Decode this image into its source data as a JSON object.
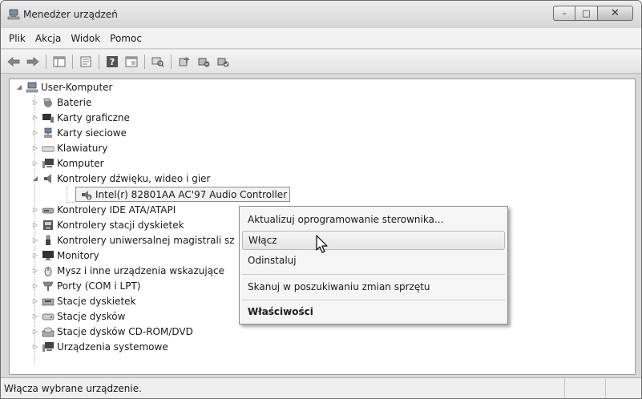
{
  "window": {
    "title": "Menedżer urządzeń",
    "title_icon": "computer-icon"
  },
  "caption": {
    "minimize": "–",
    "maximize": "□",
    "close": "✕"
  },
  "menubar": {
    "items": [
      "Plik",
      "Akcja",
      "Widok",
      "Pomoc"
    ]
  },
  "toolbar": {
    "buttons": [
      "back-arrow-icon",
      "forward-arrow-icon",
      "show-hide-console-tree-icon",
      "properties-icon",
      "help-icon",
      "console-view-icon",
      "scan-hardware-icon",
      "update-driver-icon",
      "disable-device-icon",
      "enable-device-icon"
    ]
  },
  "tree": {
    "root": {
      "label": "User-Komputer",
      "icon": "computer-icon",
      "expanded": true
    },
    "categories": [
      {
        "label": "Baterie",
        "icon": "battery-icon"
      },
      {
        "label": "Karty graficzne",
        "icon": "display-adapter-icon"
      },
      {
        "label": "Karty sieciowe",
        "icon": "network-adapter-icon"
      },
      {
        "label": "Klawiatury",
        "icon": "keyboard-icon"
      },
      {
        "label": "Komputer",
        "icon": "computer-icon"
      },
      {
        "label": "Kontrolery dźwięku, wideo i gier",
        "icon": "speaker-icon",
        "expanded": true
      },
      {
        "label": "Kontrolery IDE ATA/ATAPI",
        "icon": "ide-controller-icon"
      },
      {
        "label": "Kontrolery stacji dyskietek",
        "icon": "floppy-controller-icon"
      },
      {
        "label": "Kontrolery uniwersalnej magistrali sz",
        "icon": "usb-icon"
      },
      {
        "label": "Monitory",
        "icon": "monitor-icon"
      },
      {
        "label": "Mysz i inne urządzenia wskazujące",
        "icon": "mouse-icon"
      },
      {
        "label": "Porty (COM i LPT)",
        "icon": "port-icon"
      },
      {
        "label": "Stacje dyskietek",
        "icon": "floppy-drive-icon"
      },
      {
        "label": "Stacje dysków",
        "icon": "disk-drive-icon"
      },
      {
        "label": "Stacje dysków CD-ROM/DVD",
        "icon": "cdrom-icon"
      },
      {
        "label": "Urządzenia systemowe",
        "icon": "system-device-icon"
      }
    ],
    "selected_child": {
      "label": "Intel(r) 82801AA AC'97 Audio Controller",
      "icon": "disabled-audio-device-icon"
    }
  },
  "context_menu": {
    "items": [
      {
        "label": "Aktualizuj oprogramowanie sterownika..."
      },
      {
        "label": "Włącz",
        "hover": true
      },
      {
        "label": "Odinstaluj"
      },
      {
        "label": "Skanuj w poszukiwaniu zmian sprzętu"
      },
      {
        "label": "Właściwości",
        "bold": true
      }
    ]
  },
  "statusbar": {
    "text": "Włącza wybrane urządzenie."
  },
  "colors": {
    "window_bg": "#d9d9d9",
    "tree_bg": "#ffffff",
    "menu_bg": "#f5f5f5",
    "status_bg": "#efefef"
  }
}
